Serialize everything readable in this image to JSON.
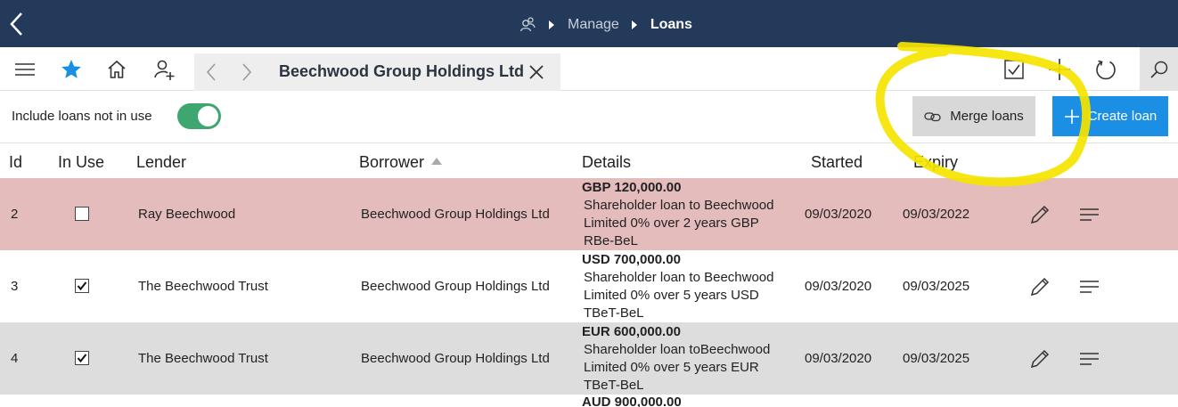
{
  "breadcrumb": {
    "manage": "Manage",
    "loans": "Loans"
  },
  "tab": {
    "title": "Beechwood Group Holdings Ltd"
  },
  "filter": {
    "include_label": "Include loans not in use",
    "include_on": true
  },
  "actions": {
    "merge_label": "Merge loans",
    "create_label": "Create loan"
  },
  "colors": {
    "topbar": "#243a5a",
    "accent": "#1a8fe3",
    "toggle": "#3ea76f",
    "highlight": "#f5e400",
    "not_in_use_row": "#e4bcbc"
  },
  "columns": {
    "id": "Id",
    "in_use": "In Use",
    "lender": "Lender",
    "borrower": "Borrower",
    "details": "Details",
    "started": "Started",
    "expiry": "Expiry"
  },
  "rows": [
    {
      "id": "2",
      "in_use": false,
      "lender": "Ray Beechwood",
      "borrower": "Beechwood Group Holdings Ltd",
      "amount": "GBP 120,000.00",
      "desc": "Shareholder loan to Beechwood Limited 0% over 2 years GBP RBe-BeL",
      "started": "09/03/2020",
      "expiry": "09/03/2022"
    },
    {
      "id": "3",
      "in_use": true,
      "lender": "The Beechwood Trust",
      "borrower": "Beechwood Group Holdings Ltd",
      "amount": "USD 700,000.00",
      "desc": "Shareholder loan to Beechwood Limited 0% over 5 years USD TBeT-BeL",
      "started": "09/03/2020",
      "expiry": "09/03/2025"
    },
    {
      "id": "4",
      "in_use": true,
      "lender": "The Beechwood Trust",
      "borrower": "Beechwood Group Holdings Ltd",
      "amount": "EUR 600,000.00",
      "desc": "Shareholder loan toBeechwood Limited 0% over 5 years EUR TBeT-BeL",
      "started": "09/03/2020",
      "expiry": "09/03/2025"
    },
    {
      "amount": "AUD 900,000.00"
    }
  ],
  "icons": [
    "back-icon",
    "contacts-icon",
    "chevron-right-icon",
    "hamburger-icon",
    "star-icon",
    "home-icon",
    "add-person-icon",
    "chevron-left-icon",
    "close-icon",
    "select-all-icon",
    "plus-icon",
    "refresh-icon",
    "search-icon",
    "link-icon",
    "pencil-icon",
    "details-icon"
  ]
}
